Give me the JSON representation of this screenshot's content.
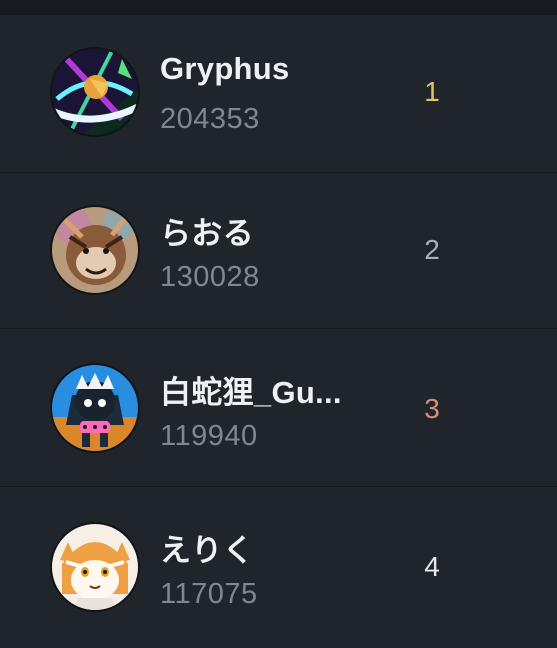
{
  "leaderboard": {
    "entries": [
      {
        "name": "Gryphus",
        "score": "204353",
        "rank": "1",
        "rank_color": "#e4c06a"
      },
      {
        "name": "らおる",
        "score": "130028",
        "rank": "2",
        "rank_color": "#a9b0b8"
      },
      {
        "name": "白蛇狸_Gu...",
        "score": "119940",
        "rank": "3",
        "rank_color": "#d88f6e"
      },
      {
        "name": "えりく",
        "score": "117075",
        "rank": "4",
        "rank_color": "#e6e9ec"
      }
    ]
  },
  "colors": {
    "background": "#1b1f24",
    "row_background": "#20252b",
    "name_text": "#eef1f4",
    "score_text": "#7f8790"
  }
}
